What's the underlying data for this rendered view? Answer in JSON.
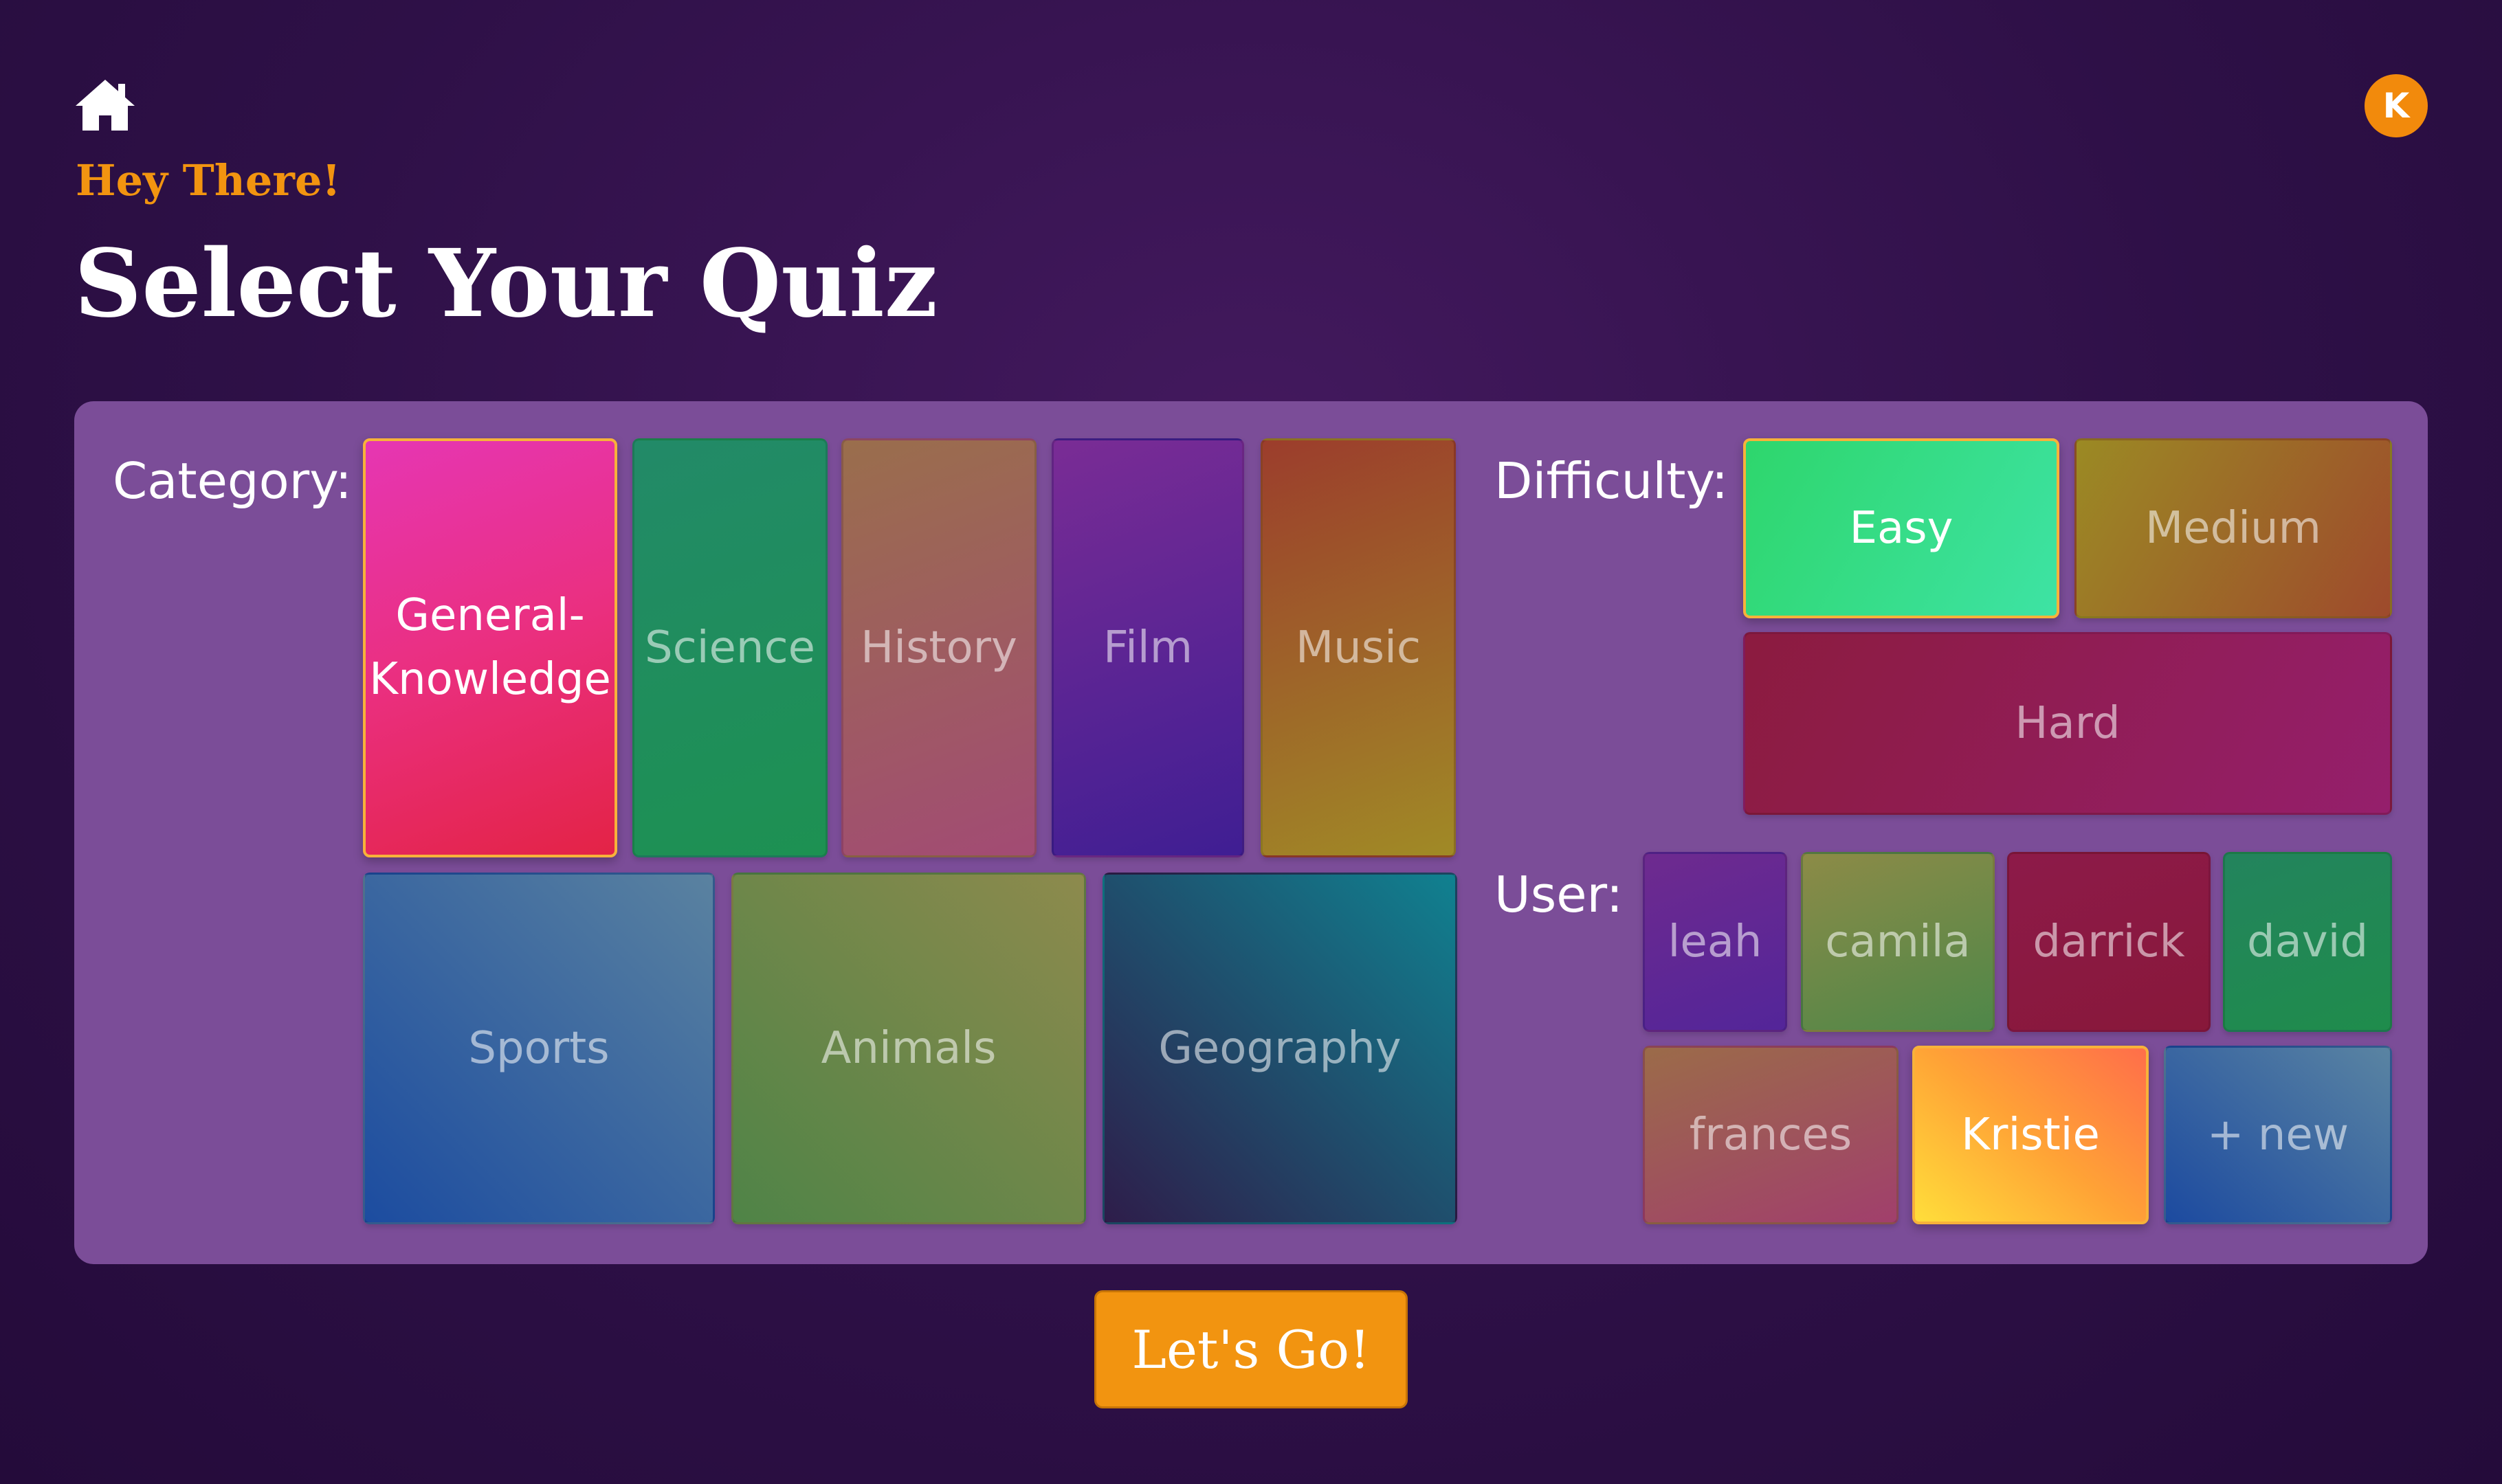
{
  "header": {
    "avatar_initial": "K",
    "greeting": "Hey There!",
    "title": "Select Your Quiz"
  },
  "panel": {
    "category_label": "Category:",
    "difficulty_label": "Difficulty:",
    "user_label": "User:",
    "categories": [
      {
        "label": "General-\nKnowledge",
        "selected": true
      },
      {
        "label": "Science",
        "selected": false
      },
      {
        "label": "History",
        "selected": false
      },
      {
        "label": "Film",
        "selected": false
      },
      {
        "label": "Music",
        "selected": false
      },
      {
        "label": "Sports",
        "selected": false
      },
      {
        "label": "Animals",
        "selected": false
      },
      {
        "label": "Geography",
        "selected": false
      }
    ],
    "difficulties": [
      {
        "label": "Easy",
        "selected": true
      },
      {
        "label": "Medium",
        "selected": false
      },
      {
        "label": "Hard",
        "selected": false
      }
    ],
    "users": [
      {
        "label": "leah",
        "selected": false
      },
      {
        "label": "camila",
        "selected": false
      },
      {
        "label": "darrick",
        "selected": false
      },
      {
        "label": "david",
        "selected": false
      },
      {
        "label": "frances",
        "selected": false
      },
      {
        "label": "Kristie",
        "selected": true
      },
      {
        "label": "+ new",
        "selected": false
      }
    ]
  },
  "actions": {
    "go_label": "Let's Go!"
  },
  "colors": {
    "accent": "#f29410",
    "panel": "#7b4d98",
    "background": "#2e1047"
  }
}
